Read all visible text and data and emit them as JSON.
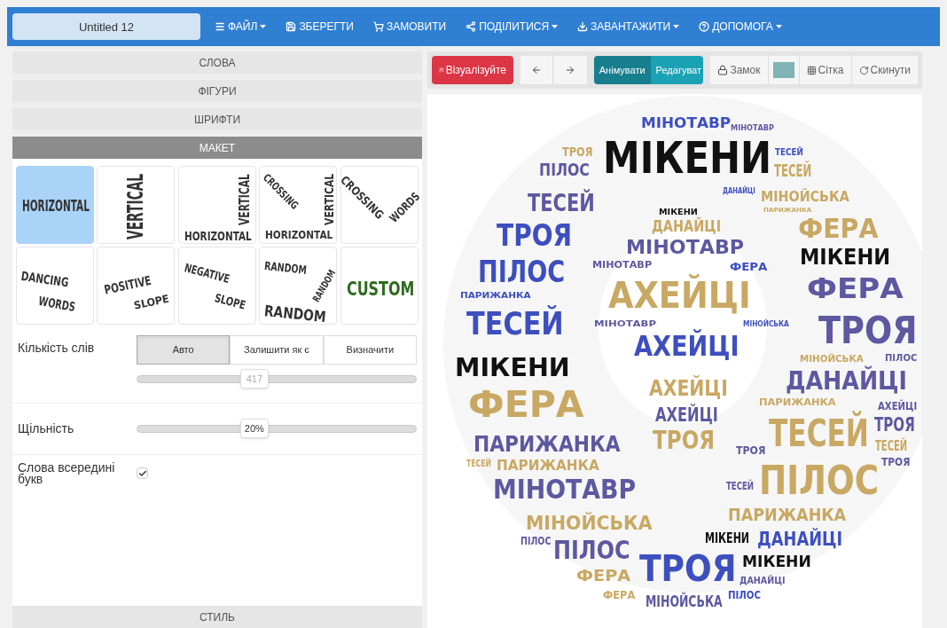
{
  "title_field": {
    "value": "Untitled 12"
  },
  "menu": [
    {
      "kind": "file",
      "label": "ФАЙЛ",
      "dropdown": true
    },
    {
      "kind": "save",
      "label": "ЗБЕРЕГТИ",
      "dropdown": false
    },
    {
      "kind": "order",
      "label": "ЗАМОВИТИ",
      "dropdown": false
    },
    {
      "kind": "share",
      "label": "ПОДІЛИТИСЯ",
      "dropdown": true
    },
    {
      "kind": "download",
      "label": "ЗАВАНТАЖИТИ",
      "dropdown": true
    },
    {
      "kind": "help",
      "label": "ДОПОМОГА",
      "dropdown": true
    }
  ],
  "sections_top": [
    {
      "label": "СЛОВА",
      "expanded": false
    },
    {
      "label": "ФІГУРИ",
      "expanded": false
    },
    {
      "label": "ШРИФТИ",
      "expanded": false
    },
    {
      "label": "МАКЕТ",
      "expanded": true
    }
  ],
  "layouts": [
    {
      "kind": "horizontal",
      "words": [
        "HORIZONTAL"
      ],
      "selected": true
    },
    {
      "kind": "vertical",
      "words": [
        "VERTICAL"
      ],
      "selected": false
    },
    {
      "kind": "horizontal_vertical",
      "words": [
        "VERTICAL",
        "HORIZONTAL"
      ],
      "selected": false
    },
    {
      "kind": "crossing",
      "words": [
        "CROSSING",
        "VERTICAL",
        "HORIZONTAL"
      ],
      "selected": false
    },
    {
      "kind": "crossing_words",
      "words": [
        "CROSSING",
        "WORDS"
      ],
      "selected": false
    },
    {
      "kind": "dancing",
      "words": [
        "DANCING",
        "WORDS"
      ],
      "selected": false
    },
    {
      "kind": "positive_slope",
      "words": [
        "POSITIVE",
        "SLOPE"
      ],
      "selected": false
    },
    {
      "kind": "negative_slope",
      "words": [
        "NEGATIVE",
        "SLOPE"
      ],
      "selected": false
    },
    {
      "kind": "random",
      "words": [
        "RANDOM",
        "RANDOM",
        "RANDOM"
      ],
      "selected": false
    },
    {
      "kind": "custom",
      "words": [
        "CUSTOM"
      ],
      "selected": false
    }
  ],
  "word_count": {
    "label": "Кількість слів",
    "options": [
      {
        "label": "Авто",
        "selected": true
      },
      {
        "label": "Залишити як є",
        "selected": false
      },
      {
        "label": "Визначити",
        "selected": false
      }
    ],
    "slider": {
      "reading": "417",
      "level": 0.42,
      "disabled": true
    }
  },
  "density": {
    "label": "Щільність",
    "slider": {
      "reading": "20%",
      "level": 0.42,
      "disabled": false
    }
  },
  "inside_letters": {
    "label": "Слова всередині букв",
    "checked": true
  },
  "section_bottom": {
    "label": "СТИЛЬ",
    "expanded": false
  },
  "toolbar": [
    {
      "kind": "visualize",
      "label": "Візуалізуйте"
    },
    {
      "kind": "undo"
    },
    {
      "kind": "redo"
    },
    {
      "kind": "toggle",
      "options": [
        {
          "label": "Анімувати",
          "selected": true
        },
        {
          "label": "Редагуват",
          "selected": false
        }
      ]
    },
    {
      "kind": "lock",
      "label": "Замок"
    },
    {
      "kind": "swatch",
      "color": "#7fb3b5"
    },
    {
      "kind": "grid",
      "label": "Сітка"
    },
    {
      "kind": "reset",
      "label": "Скинути"
    }
  ],
  "cloud_words": [
    {
      "text": "МІНОТАВР",
      "color": "#3d4fbf"
    },
    {
      "text": "МІНОТАВР",
      "color": "#5d58a0"
    },
    {
      "text": "ТРОЯ",
      "color": "#c8a862"
    },
    {
      "text": "ПІЛОС",
      "color": "#5d58a0"
    },
    {
      "text": "МІКЕНИ",
      "color": "#111111"
    },
    {
      "text": "ТЕСЕЙ",
      "color": "#3d4fbf"
    },
    {
      "text": "ТЕСЕЙ",
      "color": "#c8a862"
    },
    {
      "text": "ТЕСЕЙ",
      "color": "#5d58a0"
    },
    {
      "text": "ДАНАЙЦІ",
      "color": "#3d4fbf"
    },
    {
      "text": "МІНОЙСЬКА",
      "color": "#c8a862"
    },
    {
      "text": "ПАРИЖАНКА",
      "color": "#c8a862"
    },
    {
      "text": "ТРОЯ",
      "color": "#3d4fbf"
    },
    {
      "text": "МІКЕНИ",
      "color": "#111111"
    },
    {
      "text": "ДАНАЙЦІ",
      "color": "#c8a862"
    },
    {
      "text": "ФЕРА",
      "color": "#c8a862"
    },
    {
      "text": "ПІЛОС",
      "color": "#3d4fbf"
    },
    {
      "text": "МІНОТАВР",
      "color": "#5d58a0"
    },
    {
      "text": "МІНОТАВР",
      "color": "#5d58a0"
    },
    {
      "text": "ФЕРА",
      "color": "#3d4fbf"
    },
    {
      "text": "МІКЕНИ",
      "color": "#111111"
    },
    {
      "text": "ПАРИЖАНКА",
      "color": "#3d4fbf"
    },
    {
      "text": "АХЕЙЦІ",
      "color": "#c8a862"
    },
    {
      "text": "ФЕРА",
      "color": "#5d58a0"
    },
    {
      "text": "ТЕСЕЙ",
      "color": "#3d4fbf"
    },
    {
      "text": "МІНОТАВР",
      "color": "#5d58a0"
    },
    {
      "text": "АХЕЙЦІ",
      "color": "#3d4fbf"
    },
    {
      "text": "МІНОЙСЬКА",
      "color": "#3d4fbf"
    },
    {
      "text": "ТРОЯ",
      "color": "#5d58a0"
    },
    {
      "text": "МІКЕНИ",
      "color": "#111111"
    },
    {
      "text": "ФЕРА",
      "color": "#c8a862"
    },
    {
      "text": "АХЕЙЦІ",
      "color": "#c8a862"
    },
    {
      "text": "МІНОЙСЬКА",
      "color": "#c8a862"
    },
    {
      "text": "ПІЛОС",
      "color": "#5d58a0"
    },
    {
      "text": "ДАНАЙЦІ",
      "color": "#5d58a0"
    },
    {
      "text": "АХЕЙЦІ",
      "color": "#5d58a0"
    },
    {
      "text": "ПАРИЖАНКА",
      "color": "#c8a862"
    },
    {
      "text": "АХЕЙЦІ",
      "color": "#5d58a0"
    },
    {
      "text": "ПАРИЖАНКА",
      "color": "#5d58a0"
    },
    {
      "text": "ТРОЯ",
      "color": "#c8a862"
    },
    {
      "text": "ТРОЯ",
      "color": "#5d58a0"
    },
    {
      "text": "ТЕСЕЙ",
      "color": "#c8a862"
    },
    {
      "text": "ТРОЯ",
      "color": "#5d58a0"
    },
    {
      "text": "ТЕСЕЙ",
      "color": "#c8a862"
    },
    {
      "text": "ТЕСЕЙ",
      "color": "#c8a862"
    },
    {
      "text": "ПАРИЖАНКА",
      "color": "#c8a862"
    },
    {
      "text": "МІНОТАВР",
      "color": "#5d58a0"
    },
    {
      "text": "ТЕСЕЙ",
      "color": "#5d58a0"
    },
    {
      "text": "ПІЛОС",
      "color": "#c8a862"
    },
    {
      "text": "ТРОЯ",
      "color": "#5d58a0"
    },
    {
      "text": "МІНОЙСЬКА",
      "color": "#c8a862"
    },
    {
      "text": "ПАРИЖАНКА",
      "color": "#c8a862"
    },
    {
      "text": "ПІЛОС",
      "color": "#5d58a0"
    },
    {
      "text": "ПІЛОС",
      "color": "#5d58a0"
    },
    {
      "text": "ФЕРА",
      "color": "#c8a862"
    },
    {
      "text": "МІКЕНИ",
      "color": "#111111"
    },
    {
      "text": "ДАНАЙЦІ",
      "color": "#3d4fbf"
    },
    {
      "text": "МІКЕНИ",
      "color": "#111111"
    },
    {
      "text": "ФЕРА",
      "color": "#c8a862"
    },
    {
      "text": "ТРОЯ",
      "color": "#3d4fbf"
    },
    {
      "text": "МІНОЙСЬКА",
      "color": "#5d58a0"
    },
    {
      "text": "ДАНАЙЦІ",
      "color": "#5d58a0"
    },
    {
      "text": "ПІЛОС",
      "color": "#3d4fbf"
    }
  ]
}
